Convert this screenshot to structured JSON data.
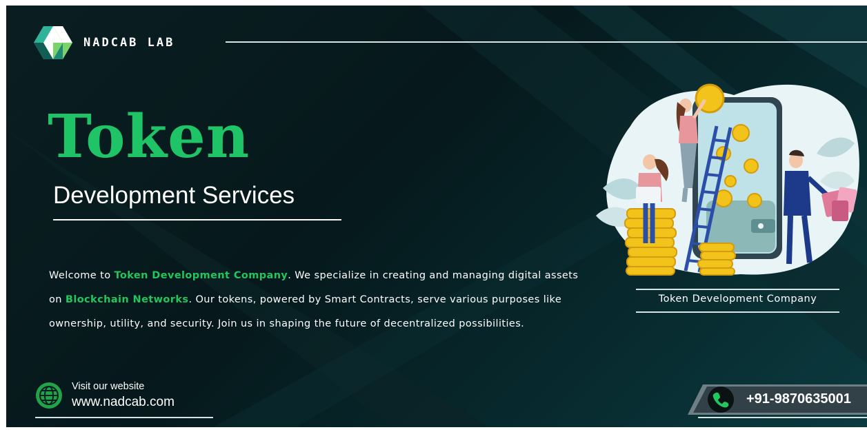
{
  "brand": {
    "name": "NADCAB LAB",
    "logo_icon": "hexagon-diamond-logo-icon",
    "colors": {
      "teal": "#1f8a78",
      "green": "#7bd46a",
      "white": "#ffffff"
    }
  },
  "hero": {
    "title": "Token",
    "subtitle": "Development Services",
    "title_color": "#1ec466"
  },
  "intro": {
    "part1": "Welcome to ",
    "highlight1": "Token Development Company",
    "part2": ". We specialize in creating and managing digital assets on ",
    "highlight2": "Blockchain Networks",
    "part3": ". Our tokens, powered by Smart Contracts, serve various purposes like ownership, utility, and security. Join us in shaping the future of decentralized possibilities.",
    "highlight_color": "#22c55e"
  },
  "illustration": {
    "caption": "Token Development Company",
    "icon": "token-development-illustration"
  },
  "contact": {
    "website_label": "Visit our website",
    "website_url": "www.nadcab.com",
    "website_icon": "globe-icon",
    "phone": "+91-9870635001",
    "phone_icon": "phone-icon"
  },
  "colors": {
    "background": "#06181b",
    "accent_green": "#1ec466",
    "coin_gold": "#f2c31b"
  }
}
